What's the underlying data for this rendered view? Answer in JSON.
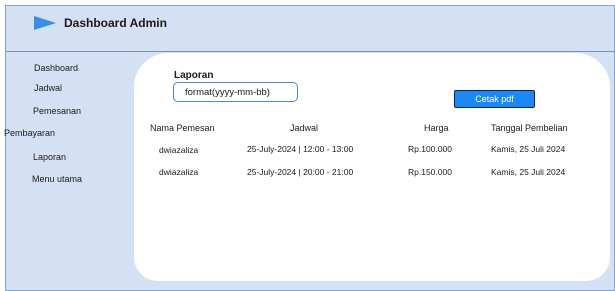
{
  "header": {
    "title": "Dashboard Admin",
    "logo_icon": "play-triangle-icon",
    "logo_color": "#3a8ee6"
  },
  "sidebar": {
    "items": [
      {
        "label": "Dashboard"
      },
      {
        "label": "Jadwal"
      },
      {
        "label": "Pemesanan"
      },
      {
        "label": "Pembayaran"
      },
      {
        "label": "Laporan"
      },
      {
        "label": "Menu utama"
      }
    ]
  },
  "report": {
    "title": "Laporan",
    "date_placeholder": "format(yyyy-mm-bb)",
    "export_label": "Cetak pdf",
    "export_color": "#1a88f5"
  },
  "table": {
    "headers": [
      "Nama Pemesan",
      "Jadwal",
      "Harga",
      "Tanggal Pembelian"
    ],
    "rows": [
      [
        "dwiazaliza",
        "25-July-2024 | 12:00 - 13:00",
        "Rp.100.000",
        "Kamis, 25 Juli 2024"
      ],
      [
        "dwiazaliza",
        "25-July-2024 | 20:00 - 21:00",
        "Rp.150.000",
        "Kamis, 25 Juli 2024"
      ]
    ]
  },
  "colors": {
    "background": "#d4e1f5",
    "card": "#ffffff"
  }
}
